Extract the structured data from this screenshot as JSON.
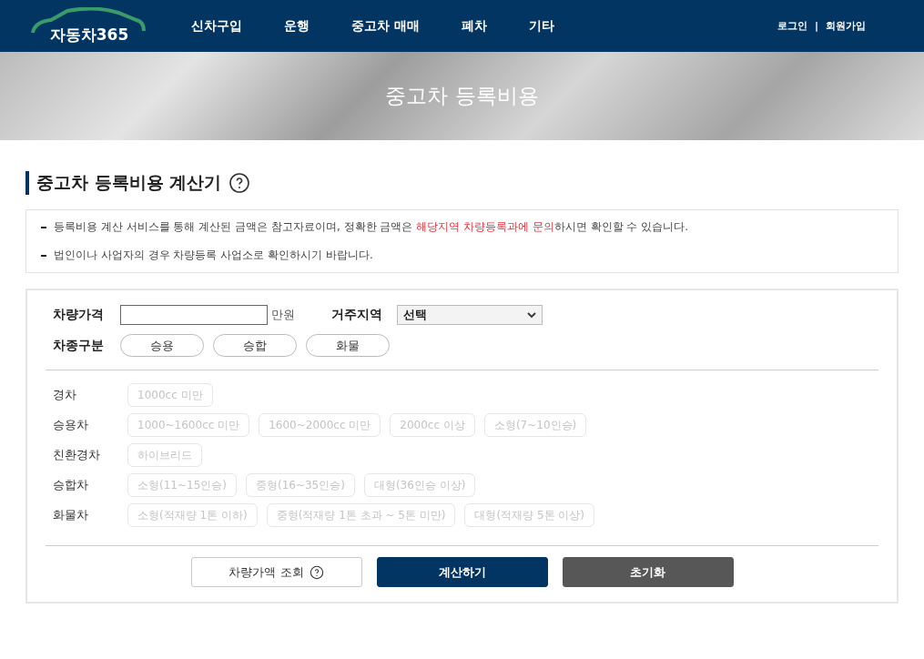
{
  "header": {
    "logo": "자동차365",
    "nav": [
      "신차구입",
      "운행",
      "중고차 매매",
      "폐차",
      "기타"
    ],
    "auth": [
      "로그인",
      "회원가입"
    ],
    "auth_separator": "|"
  },
  "banner": {
    "title": "중고차 등록비용"
  },
  "section": {
    "title": "중고차 등록비용 계산기"
  },
  "notices": [
    [
      {
        "text": "등록비용 계산 서비스를 통해 계산된 금액은 참고자료이며, 정확한 금액은 ",
        "highlight": false
      },
      {
        "text": "해당지역 차량등록과에 문의",
        "highlight": true
      },
      {
        "text": "하시면 확인할 수 있습니다.",
        "highlight": false
      }
    ],
    [
      {
        "text": "법인이나 사업자의 경우 차량등록 사업소로 확인하시기 바랍니다.",
        "highlight": false
      }
    ]
  ],
  "form": {
    "price_label": "차량가격",
    "price_unit": "만원",
    "region_label": "거주지역",
    "region_value": "선택",
    "type_label": "차종구분",
    "types": [
      {
        "label": "승용",
        "selected": false
      },
      {
        "label": "승합",
        "selected": false
      },
      {
        "label": "화물",
        "selected": false
      }
    ]
  },
  "categories": [
    {
      "label": "경차",
      "options": [
        {
          "label": "1000cc 미만",
          "disabled": true
        }
      ]
    },
    {
      "label": "승용차",
      "options": [
        {
          "label": "1000~1600cc 미만",
          "disabled": true
        },
        {
          "label": "1600~2000cc 미만",
          "disabled": true
        },
        {
          "label": "2000cc 이상",
          "disabled": true
        },
        {
          "label": "소형(7~10인승)",
          "disabled": true
        }
      ]
    },
    {
      "label": "친환경차",
      "options": [
        {
          "label": "하이브리드",
          "disabled": true
        }
      ]
    },
    {
      "label": "승합차",
      "options": [
        {
          "label": "소형(11~15인승)",
          "disabled": true
        },
        {
          "label": "중형(16~35인승)",
          "disabled": true
        },
        {
          "label": "대형(36인승 이상)",
          "disabled": true
        }
      ]
    },
    {
      "label": "화물차",
      "options": [
        {
          "label": "소형(적재량 1톤 이하)",
          "disabled": true
        },
        {
          "label": "중형(적재량 1톤 초과 ~ 5톤 미만)",
          "disabled": true
        },
        {
          "label": "대형(적재량 5톤 이상)",
          "disabled": true
        }
      ]
    }
  ],
  "buttons": [
    {
      "label": "차량가액 조회",
      "kind": "outline"
    },
    {
      "label": "계산하기",
      "kind": "primary"
    },
    {
      "label": "초기화",
      "kind": "secondary"
    }
  ]
}
